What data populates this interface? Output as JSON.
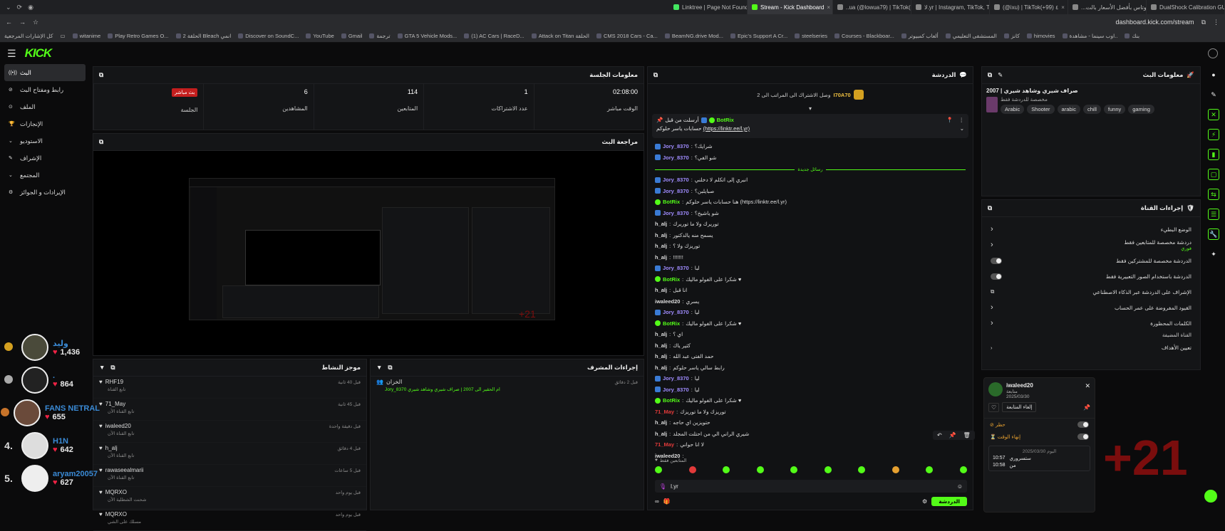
{
  "browser": {
    "tabs": [
      {
        "label": "Linktree | Page Not Found",
        "color": "#43e660"
      },
      {
        "label": "Stream - Kick Dashboard",
        "color": "#53fc18"
      },
      {
        "label": "..ua (@lowua79) | TikTok(+99)",
        "color": "#888888"
      },
      {
        "label": "ﻻ.yr | Instagram, TikTok, Twitch",
        "color": "#888888"
      },
      {
        "label": "(@ixu) | TikTok(+99) ٤",
        "color": "#888888"
      },
      {
        "label": "...اشترى لوتاس بأفضل الأسعار بالت",
        "color": "#888888"
      },
      {
        "label": "DualShock Calibration GUI",
        "color": "#888888"
      }
    ],
    "url": "dashboard.kick.com/stream",
    "bookmarks_right": "كل الإشارات المرجعية",
    "bookmarks": [
      "بنك",
      "اوب سينما - مشاهدة..",
      "himovies",
      "كانز",
      "المستشفى التعليمي",
      "ألعاب كمبيوتر",
      "Courses - Blackboar...",
      "steelseries",
      "Epic's Support A Cr...",
      "BeamNG.drive Mod...",
      "CMS 2018 Cars - Ca...",
      "Attack on Titan الحلقة",
      "(1) AC Cars | RaceD...",
      "GTA 5 Vehicle Mods...",
      "ترجمة",
      "Gmail",
      "YouTube",
      "Discover on SoundC...",
      "الحلقة 2 Bleach انمي",
      "Play Retro Games O...",
      "witanime"
    ]
  },
  "nav": {
    "logo": "KICK"
  },
  "sidebar": {
    "items": [
      {
        "label": "البث",
        "icon": "live-icon",
        "active": true
      },
      {
        "label": "رابط ومفتاح البث",
        "icon": "link-icon"
      },
      {
        "label": "الملف",
        "icon": "file-icon"
      },
      {
        "label": "الإنجازات",
        "icon": "trophy-icon"
      },
      {
        "label": "الاستوديو",
        "icon": "studio-icon"
      },
      {
        "label": "الإشراف",
        "icon": "shield-icon"
      },
      {
        "label": "المجتمع",
        "icon": "community-icon"
      },
      {
        "label": "الإيرادات و الجوائز",
        "icon": "money-icon"
      }
    ]
  },
  "session": {
    "title": "معلومات الجلسة",
    "stats": [
      {
        "label": "الوقت مباشر",
        "value": "02:08:00"
      },
      {
        "label": "عدد الاشتراكات",
        "value": "1"
      },
      {
        "label": "المتابعين",
        "value": "114"
      },
      {
        "label": "المشاهدين",
        "value": "6"
      },
      {
        "label": "الجلسة",
        "value": "بث مباشر"
      }
    ]
  },
  "preview": {
    "title": "مراجعة البث",
    "overlay_counter": "+21"
  },
  "activity": {
    "title": "موجز النشاط",
    "items": [
      {
        "name": "RHF19",
        "sub": "تابع القناة",
        "time": "قبل 40 ثانية"
      },
      {
        "name": "71_May",
        "sub": "تابع القناة الآن",
        "time": "قبل 45 ثانية"
      },
      {
        "name": "iwaleed20",
        "sub": "تابع القناة الآن",
        "time": "قبل دقيقة واحدة"
      },
      {
        "name": "h_alj",
        "sub": "تابع القناة الآن",
        "time": "قبل 4 دقائق"
      },
      {
        "name": "rawaseealmarii",
        "sub": "تابع القناة الآن",
        "time": "قبل 5 ساعات"
      },
      {
        "name": "MQRXO",
        "sub": "شحنت الشطلية الآن",
        "time": "قبل يوم واحد"
      },
      {
        "name": "MQRXO",
        "sub": "مسلك على الشي",
        "time": "قبل يوم واحد"
      }
    ]
  },
  "mod": {
    "title": "إجراءات المشرف",
    "items": [
      {
        "actor": "الخزان",
        "text": "Jory_8370 ام الحقير الى 2007 | صراف شيري وشاهد شيري",
        "time": "قبل 2 دقائق"
      }
    ]
  },
  "chat": {
    "title": "الدردشة",
    "top_user": "I70A70",
    "top_user_note": "وصل الاشتراك الى المراتب الى 2",
    "pinned_by": "أرسلت من قبل",
    "pinned_bot": "BotRix",
    "pinned_text": "حسابات ياسر حلوكم",
    "pinned_link": "(https://linktr.ee/l.yr)",
    "new_messages": "رسائل جديدة",
    "messages": [
      {
        "user": "Jory_8370",
        "text": "شرايك؟",
        "color": "#a08cff"
      },
      {
        "user": "Jory_8370",
        "text": "شو الفي؟",
        "color": "#a08cff"
      },
      {
        "user": "Jory_8370",
        "text": "انبري إلى اتكلم لا دخلني",
        "color": "#a08cff"
      },
      {
        "user": "Jory_8370",
        "text": "صبايلبن؟",
        "color": "#a08cff"
      },
      {
        "user": "BotRix",
        "text": "هنا حسابات ياسر حلوكم (https://linktr.ee/l.yr)",
        "color": "#53fc18"
      },
      {
        "user": "Jory_8370",
        "text": "شو ياشيخ؟",
        "color": "#a08cff"
      },
      {
        "user": "h_alj",
        "text": "توريرك ولا ما توريرك",
        "color": "#dddddd"
      },
      {
        "user": "h_alj",
        "text": "يسمح منه يالدكتور",
        "color": "#dddddd"
      },
      {
        "user": "h_alj",
        "text": "توريزك ولا ؟",
        "color": "#dddddd"
      },
      {
        "user": "h_alj",
        "text": "!!!!!!!",
        "color": "#dddddd"
      },
      {
        "user": "Jory_8370",
        "text": "لبا",
        "color": "#a08cff"
      },
      {
        "user": "BotRix",
        "text": "شكرا على الفولو ماليك ♥",
        "color": "#53fc18"
      },
      {
        "user": "h_alj",
        "text": "انا قبل",
        "color": "#dddddd"
      },
      {
        "user": "iwaleed20",
        "text": "يسري",
        "color": "#dddddd"
      },
      {
        "user": "Jory_8370",
        "text": "ليا",
        "color": "#a08cff"
      },
      {
        "user": "BotRix",
        "text": "شكرا على الفولو ماليك ♥",
        "color": "#53fc18"
      },
      {
        "user": "h_alj",
        "text": "اي ؟",
        "color": "#dddddd"
      },
      {
        "user": "h_alj",
        "text": "كثير ياك",
        "color": "#dddddd"
      },
      {
        "user": "h_alj",
        "text": "حمد الفتى عبد الله",
        "color": "#dddddd"
      },
      {
        "user": "h_alj",
        "text": "رابط سالي ياسر حلوكم",
        "color": "#dddddd"
      },
      {
        "user": "Jory_8370",
        "text": "ليا",
        "color": "#a08cff"
      },
      {
        "user": "Jory_8370",
        "text": "ليا",
        "color": "#a08cff"
      },
      {
        "user": "BotRix",
        "text": "شكرا على الفولو ماليك ♥",
        "color": "#53fc18"
      },
      {
        "user": "71_May",
        "text": "توريزك ولا ما توريزك",
        "color": "#e23a3a"
      },
      {
        "user": "h_alj",
        "text": "حتويزين اي حاجه",
        "color": "#dddddd"
      },
      {
        "user": "h_alj",
        "text": "شيري الراني الي من احتلت المجلد",
        "color": "#dddddd"
      },
      {
        "user": "71_May",
        "text": "لا انا حواني",
        "color": "#e23a3a"
      },
      {
        "user": "iwaleed20",
        "text": "",
        "color": "#dddddd"
      }
    ],
    "followers_label": "المتابعين فقط",
    "input_value": "l.yr",
    "send_label": "الدردشة"
  },
  "stream_info": {
    "title": "معلومات البث",
    "stream_title": "2007 | صراف شيري وشاهد شيري",
    "category": "مخصصة للدردشة فقط",
    "tags": [
      "Arabic",
      "Shooter",
      "arabic",
      "chill",
      "funny",
      "gaming"
    ]
  },
  "channel_actions": {
    "title": "إجراءات القناة",
    "rows": [
      {
        "label": "الوضع البطيء",
        "kind": "chevron"
      },
      {
        "label": "دردشة مخصصة للمتابعين فقط",
        "sub": "فوري",
        "kind": "chevron"
      },
      {
        "label": "الدردشة مخصصة للمشتركين فقط",
        "kind": "toggle"
      },
      {
        "label": "الدردشة باستخدام الصور التعبيرية فقط",
        "kind": "toggle"
      },
      {
        "label": "الإشراف على الدردشة عبر الذكاء الاصطناعي",
        "kind": "link"
      },
      {
        "label": "القيود المفروضة على عمر الحساب",
        "kind": "chevron"
      },
      {
        "label": "الكلمات المحظورة",
        "kind": "chevron"
      }
    ],
    "section_label": "القناة المضيفة",
    "goals_label": "تعيين الأهداف"
  },
  "user_card": {
    "username": "iwaleed20",
    "sub1": "متابعة",
    "sub2": "2025/03/30",
    "follow_btn": "إلغاء المتابعة",
    "ban_label": "حظر",
    "timeout_label": "إنهاء الوقت",
    "date_label": "2025/03/30 اليوم",
    "log": [
      {
        "time": "10:57",
        "text": "ستسروري"
      },
      {
        "time": "10:58",
        "text": "من"
      }
    ]
  },
  "overlay": {
    "counter": "+21",
    "leaderboard": [
      {
        "rank": "",
        "name": "وليد",
        "count": "1,436",
        "medal": "#d4a020"
      },
      {
        "rank": "",
        "name": ".",
        "count": "864",
        "medal": "#aaaaaa"
      },
      {
        "rank": "",
        "name": "FANS NETRAL",
        "count": "655",
        "medal": "#c8742a"
      },
      {
        "rank": "4.",
        "name": "H1N",
        "count": "642",
        "medal": ""
      },
      {
        "rank": "5.",
        "name": "aryam20057",
        "count": "627",
        "medal": ""
      }
    ]
  },
  "colors": {
    "accent": "#53fc18",
    "bg": "#0b0b0c",
    "panel": "#141517",
    "overlay_red": "#7a0d0d"
  }
}
